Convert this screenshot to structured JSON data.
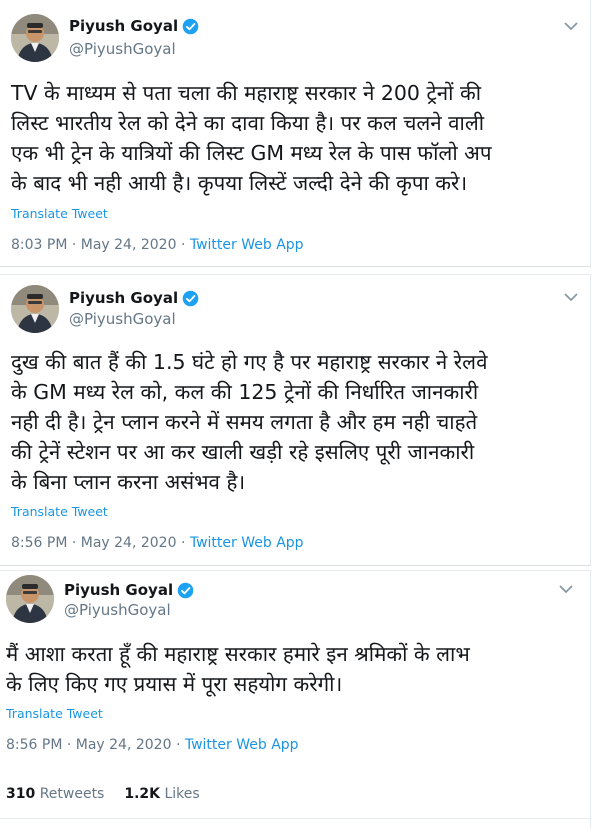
{
  "colors": {
    "link": "#1b95e0",
    "muted": "#657786",
    "text": "#14171a",
    "verified": "#1da1f2"
  },
  "tweets": [
    {
      "author_name": "Piyush Goyal",
      "author_handle": "@PiyushGoyal",
      "text": "TV के माध्यम से पता चला की महाराष्ट्र सरकार ने 200 ट्रेनों की\nलिस्ट भारतीय रेल को देने का दावा किया है। पर कल चलने वाली\nएक भी ट्रेन के यात्रियों की लिस्ट GM मध्य रेल के पास फॉलो अप\nके बाद भी नही आयी है। कृपया लिस्टें जल्दी देने की कृपा करे।",
      "translate_label": "Translate Tweet",
      "time": "8:03 PM · May 24, 2020 · ",
      "source": "Twitter Web App"
    },
    {
      "author_name": "Piyush Goyal",
      "author_handle": "@PiyushGoyal",
      "text": "दुख की बात हैं की 1.5 घंटे हो गए है पर महाराष्ट्र सरकार ने रेलवे\nके GM मध्य रेल को, कल की 125 ट्रेनों की निर्धारित जानकारी\nनही दी है। ट्रेन प्लान करने में समय लगता है और हम नही चाहते\nकी ट्रेनें स्टेशन पर आ कर खाली खड़ी रहे इसलिए पूरी जानकारी\nके बिना प्लान करना असंभव है।",
      "translate_label": "Translate Tweet",
      "time": "8:56 PM · May 24, 2020 · ",
      "source": "Twitter Web App"
    },
    {
      "author_name": "Piyush Goyal",
      "author_handle": "@PiyushGoyal",
      "text": "मैं आशा करता हूँ की महाराष्ट्र सरकार हमारे इन श्रमिकों के लाभ\nके लिए किए गए प्रयास में पूरा सहयोग करेगी।",
      "translate_label": "Translate Tweet",
      "time": "8:56 PM · May 24, 2020 · ",
      "source": "Twitter Web App"
    }
  ],
  "stats": {
    "retweets_count": "310",
    "retweets_label": "Retweets",
    "likes_count": "1.2K",
    "likes_label": "Likes"
  }
}
